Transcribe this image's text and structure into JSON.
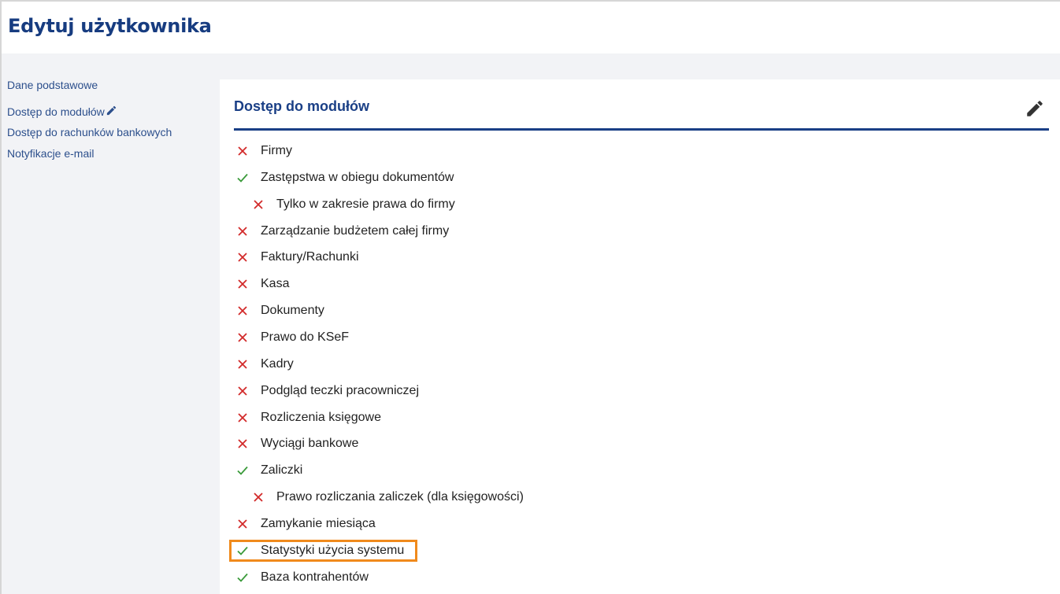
{
  "header": {
    "title": "Edytuj użytkownika"
  },
  "sidebar": {
    "items": [
      {
        "label": "Dane podstawowe",
        "active": false
      },
      {
        "label": "Dostęp do modułów",
        "active": true
      },
      {
        "label": "Dostęp do rachunków bankowych",
        "active": false
      },
      {
        "label": "Notyfikacje e-mail",
        "active": false
      }
    ]
  },
  "panel": {
    "title": "Dostęp do modułów",
    "modules": [
      {
        "label": "Firmy",
        "granted": false,
        "level": 0
      },
      {
        "label": "Zastępstwa w obiegu dokumentów",
        "granted": true,
        "level": 0
      },
      {
        "label": "Tylko w zakresie prawa do firmy",
        "granted": false,
        "level": 1
      },
      {
        "label": "Zarządzanie budżetem całej firmy",
        "granted": false,
        "level": 0
      },
      {
        "label": "Faktury/Rachunki",
        "granted": false,
        "level": 0
      },
      {
        "label": "Kasa",
        "granted": false,
        "level": 0
      },
      {
        "label": "Dokumenty",
        "granted": false,
        "level": 0
      },
      {
        "label": "Prawo do KSeF",
        "granted": false,
        "level": 0
      },
      {
        "label": "Kadry",
        "granted": false,
        "level": 0
      },
      {
        "label": "Podgląd teczki pracowniczej",
        "granted": false,
        "level": 0
      },
      {
        "label": "Rozliczenia księgowe",
        "granted": false,
        "level": 0
      },
      {
        "label": "Wyciągi bankowe",
        "granted": false,
        "level": 0
      },
      {
        "label": "Zaliczki",
        "granted": true,
        "level": 0
      },
      {
        "label": "Prawo rozliczania zaliczek (dla księgowości)",
        "granted": false,
        "level": 1
      },
      {
        "label": "Zamykanie miesiąca",
        "granted": false,
        "level": 0
      },
      {
        "label": "Statystyki użycia systemu",
        "granted": true,
        "level": 0,
        "highlighted": true
      },
      {
        "label": "Baza kontrahentów",
        "granted": true,
        "level": 0
      }
    ]
  },
  "colors": {
    "title": "#173c80",
    "accent": "#1a3f86",
    "granted": "#3a9a3a",
    "denied": "#d22a2a",
    "highlight": "#f08a1c"
  },
  "icons": {
    "sidebar_active": "pencil-icon",
    "panel_edit": "pencil-icon",
    "granted": "check-icon",
    "denied": "cross-icon"
  }
}
